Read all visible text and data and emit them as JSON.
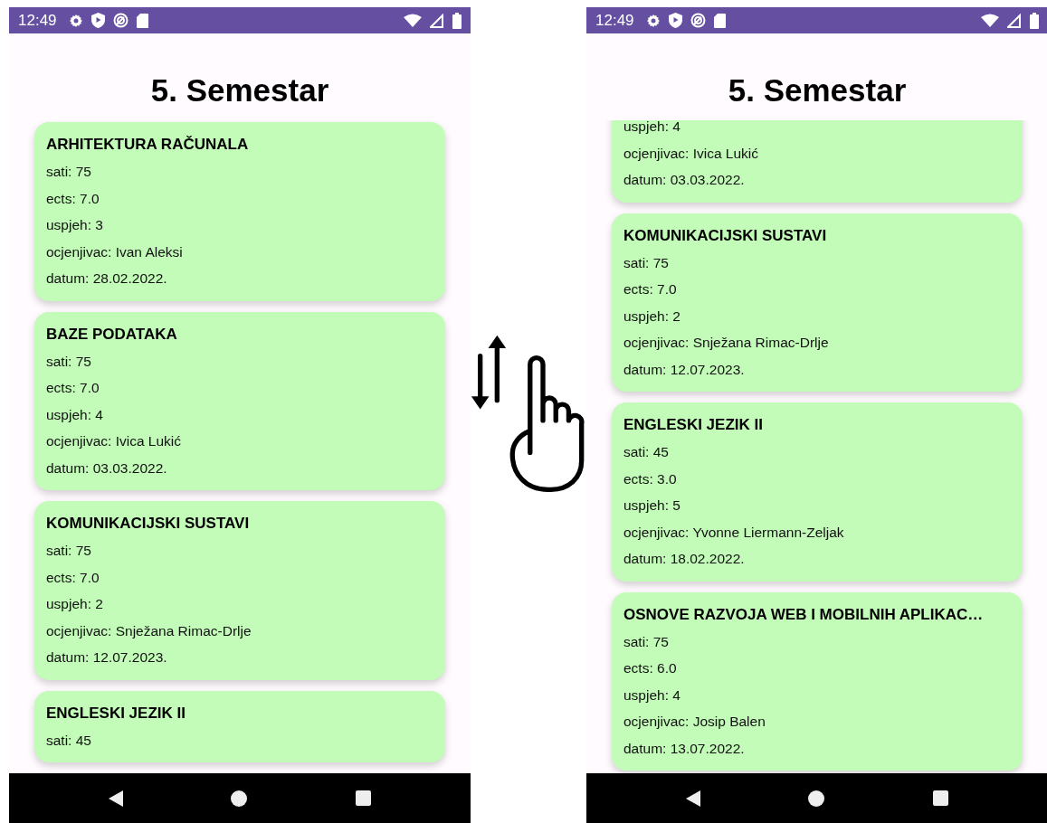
{
  "screens": [
    {
      "status_time": "12:49",
      "title": "5. Semestar",
      "cards": [
        {
          "clipped_top": false,
          "name": "ARHITEKTURA RAČUNALA",
          "fields": [
            "sati: 75",
            "ects: 7.0",
            "uspjeh: 3",
            "ocjenjivac: Ivan Aleksi",
            "datum: 28.02.2022."
          ]
        },
        {
          "clipped_top": false,
          "name": "BAZE PODATAKA",
          "fields": [
            "sati: 75",
            "ects: 7.0",
            "uspjeh: 4",
            "ocjenjivac: Ivica Lukić",
            "datum: 03.03.2022."
          ]
        },
        {
          "clipped_top": false,
          "name": "KOMUNIKACIJSKI SUSTAVI",
          "fields": [
            "sati: 75",
            "ects: 7.0",
            "uspjeh: 2",
            "ocjenjivac: Snježana Rimac-Drlje",
            "datum: 12.07.2023."
          ]
        },
        {
          "clipped_top": false,
          "name": "ENGLESKI JEZIK II",
          "fields": [
            "sati: 45"
          ]
        }
      ]
    },
    {
      "status_time": "12:49",
      "title": "5. Semestar",
      "cards": [
        {
          "clipped_top": true,
          "fields": [
            "uspjeh: 4",
            "ocjenjivac: Ivica Lukić",
            "datum: 03.03.2022."
          ]
        },
        {
          "clipped_top": false,
          "name": "KOMUNIKACIJSKI SUSTAVI",
          "fields": [
            "sati: 75",
            "ects: 7.0",
            "uspjeh: 2",
            "ocjenjivac: Snježana Rimac-Drlje",
            "datum: 12.07.2023."
          ]
        },
        {
          "clipped_top": false,
          "name": "ENGLESKI JEZIK II",
          "fields": [
            "sati: 45",
            "ects: 3.0",
            "uspjeh: 5",
            "ocjenjivac: Yvonne Liermann-Zeljak",
            "datum: 18.02.2022."
          ]
        },
        {
          "clipped_top": false,
          "name": "OSNOVE RAZVOJA WEB I MOBILNIH APLIKAC…",
          "fields": [
            "sati: 75",
            "ects: 6.0",
            "uspjeh: 4",
            "ocjenjivac: Josip Balen",
            "datum: 13.07.2022."
          ]
        }
      ]
    }
  ]
}
